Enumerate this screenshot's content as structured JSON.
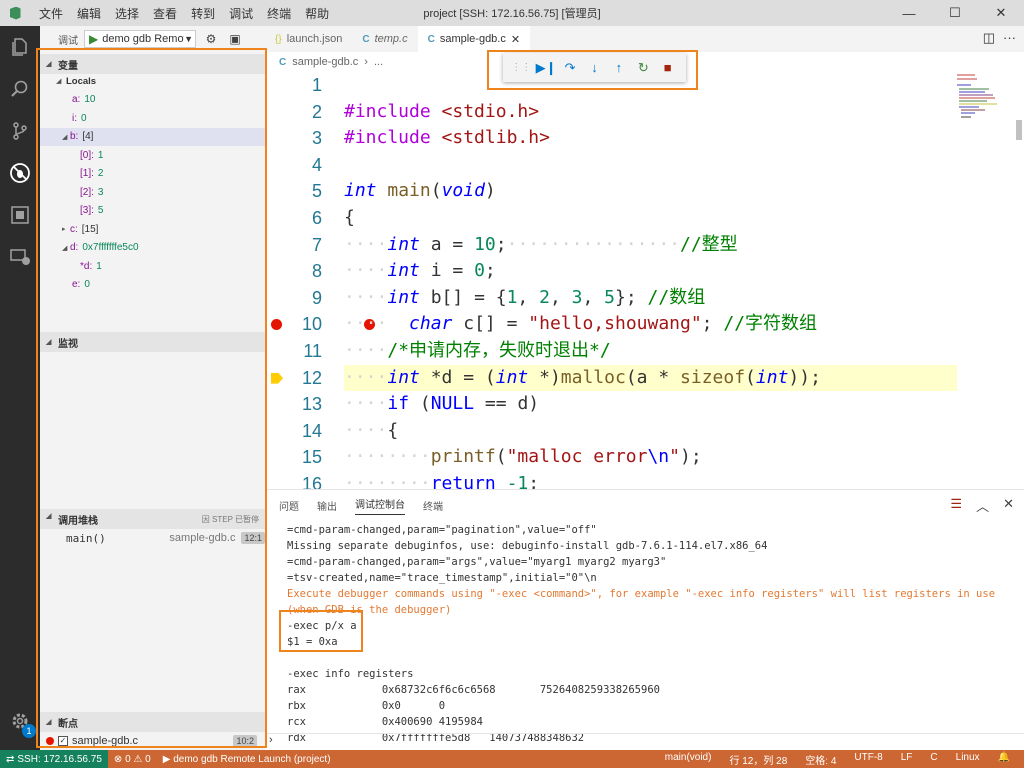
{
  "window": {
    "title": "project [SSH: 172.16.56.75] [管理员]",
    "menu": [
      "文件",
      "编辑",
      "选择",
      "查看",
      "转到",
      "调试",
      "终端",
      "帮助"
    ],
    "controls": [
      "—",
      "☐",
      "✕"
    ]
  },
  "activity": {
    "badge": "1"
  },
  "sidebar": {
    "debug_label": "调试",
    "config": "demo gdb Remote Launch (project)",
    "variables": {
      "header": "变量",
      "locals_label": "Locals",
      "rows": [
        {
          "name": "a:",
          "value": "10",
          "kind": "num"
        },
        {
          "name": "i:",
          "value": "0",
          "kind": "num"
        },
        {
          "name": "b:",
          "value": "[4]",
          "kind": "plain"
        },
        {
          "name": "[0]:",
          "value": "1",
          "kind": "num"
        },
        {
          "name": "[1]:",
          "value": "2",
          "kind": "num"
        },
        {
          "name": "[2]:",
          "value": "3",
          "kind": "num"
        },
        {
          "name": "[3]:",
          "value": "5",
          "kind": "num"
        },
        {
          "name": "c:",
          "value": "[15]",
          "kind": "plain"
        },
        {
          "name": "d:",
          "value": "0x7fffffffe5c0",
          "kind": "num"
        },
        {
          "name": "*d:",
          "value": "1",
          "kind": "num"
        },
        {
          "name": "e:",
          "value": "0",
          "kind": "num"
        }
      ]
    },
    "watch": {
      "header": "监视"
    },
    "callstack": {
      "header": "调用堆栈",
      "status": "因 STEP 已暂停",
      "frame_name": "main()",
      "frame_file": "sample-gdb.c",
      "frame_pos": "12:1"
    },
    "breakpoints": {
      "header": "断点",
      "file": "sample-gdb.c",
      "line": "10:2"
    }
  },
  "tabs": [
    {
      "icon": "{}",
      "label": "launch.json",
      "italic": false,
      "active": false
    },
    {
      "icon": "C",
      "label": "temp.c",
      "italic": true,
      "active": false
    },
    {
      "icon": "C",
      "label": "sample-gdb.c",
      "italic": false,
      "active": true
    }
  ],
  "breadcrumb": {
    "icon": "C",
    "file": "sample-gdb.c",
    "sep": "›",
    "rest": "..."
  },
  "code": {
    "lines": [
      "1",
      "2",
      "3",
      "4",
      "5",
      "6",
      "7",
      "8",
      "9",
      "10",
      "11",
      "12",
      "13",
      "14",
      "15",
      "16"
    ],
    "inc1": "#include",
    "hdr1": "<stdio.h>",
    "inc2": "#include",
    "hdr2": "<stdlib.h>",
    "kw_int": "int",
    "kw_void": "void",
    "kw_char": "char",
    "kw_if": "if",
    "kw_return": "return",
    "fn_main": "main",
    "fn_malloc": "malloc",
    "fn_sizeof": "sizeof",
    "fn_printf": "printf",
    "cmt_int": "//整型",
    "cmt_arr": "//数组",
    "cmt_chararr": "//字符数组",
    "cmt_block": "/*申请内存，失败时退出*/",
    "str_hello": "\"hello,shouwang\"",
    "str_err1": "\"malloc error",
    "str_err_esc": "\\n",
    "str_err2": "\"",
    "null_kw": "NULL",
    "n10": "10",
    "n0": "0",
    "n1": "1",
    "n2": "2",
    "n3": "3",
    "n5": "5",
    "nm1": "-1"
  },
  "panel": {
    "tabs": [
      "问题",
      "输出",
      "调试控制台",
      "终端"
    ],
    "console": [
      {
        "text": "=cmd-param-changed,param=\"pagination\",value=\"off\"",
        "cls": ""
      },
      {
        "text": "Missing separate debuginfos, use: debuginfo-install gdb-7.6.1-114.el7.x86_64",
        "cls": ""
      },
      {
        "text": "=cmd-param-changed,param=\"args\",value=\"myarg1 myarg2 myarg3\"",
        "cls": ""
      },
      {
        "text": "=tsv-created,name=\"trace_timestamp\",initial=\"0\"\\n",
        "cls": ""
      },
      {
        "text": "Execute debugger commands using \"-exec <command>\", for example \"-exec info registers\" will list registers in use",
        "cls": "warn"
      },
      {
        "text": "(when GDB is the debugger)",
        "cls": "warn"
      },
      {
        "text": "-exec p/x a",
        "cls": ""
      },
      {
        "text": "$1 = 0xa",
        "cls": ""
      },
      {
        "text": "",
        "cls": ""
      },
      {
        "text": "-exec info registers",
        "cls": ""
      },
      {
        "text": "rax            0x68732c6f6c6c6568       7526408259338265960",
        "cls": ""
      },
      {
        "text": "rbx            0x0      0",
        "cls": ""
      },
      {
        "text": "rcx            0x400690 4195984",
        "cls": ""
      },
      {
        "text": "rdx            0x7fffffffe5d8   140737488348632",
        "cls": ""
      }
    ],
    "prompt": "›"
  },
  "statusbar": {
    "remote": "SSH: 172.16.56.75",
    "errors": "0",
    "warnings": "0",
    "launch": "demo gdb Remote Launch (project)",
    "func": "main(void)",
    "pos": "行 12，列 28",
    "spaces": "空格: 4",
    "enc": "UTF-8",
    "eol": "LF",
    "lang": "C",
    "os": "Linux"
  },
  "colors": {
    "statusbar": "#cc6633",
    "remote": "#16825d",
    "highlight": "#f0841c",
    "current_line": "#ffffcc",
    "breakpoint": "#e51400"
  }
}
